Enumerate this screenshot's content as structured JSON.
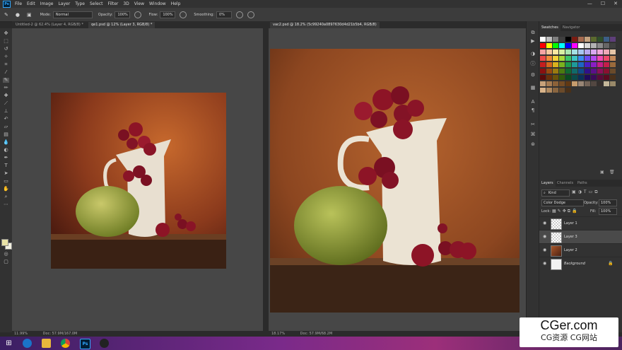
{
  "app": {
    "logo": "Ps"
  },
  "menu": [
    "File",
    "Edit",
    "Image",
    "Layer",
    "Type",
    "Select",
    "Filter",
    "3D",
    "View",
    "Window",
    "Help"
  ],
  "window_controls": [
    "—",
    "☐",
    "✕"
  ],
  "options": {
    "mode_label": "Mode:",
    "mode_value": "Normal",
    "opacity_label": "Opacity:",
    "opacity_value": "100%",
    "flow_label": "Flow:",
    "flow_value": "100%",
    "smoothing_label": "Smoothing:",
    "smoothing_value": "0%"
  },
  "tabs": {
    "left_1": "Untitled-2 @ 62.4% (Layer 4, RGB/8) *",
    "left_2": "qe1.psd @ 12% (Layer 3, RGB/8) *",
    "right_1": "vac2.psd @ 18.2% (5c99240a0897630d4d21b5b4, RGB/8)"
  },
  "status": {
    "left_zoom": "11.99%",
    "left_doc": "Doc: 57.9M/167.0M",
    "right_zoom": "18.17%",
    "right_doc": "Doc: 57.9M/68.2M"
  },
  "panels": {
    "swatches_tab": "Swatches",
    "navigator_tab": "Navigator",
    "layers_tab": "Layers",
    "channels_tab": "Channels",
    "paths_tab": "Paths",
    "kind_label": "Kind",
    "blend_mode": "Color Dodge",
    "opacity_label": "Opacity:",
    "opacity_value": "100%",
    "lock_label": "Lock:",
    "fill_label": "Fill:",
    "fill_value": "100%"
  },
  "layers": [
    {
      "name": "Layer 1",
      "selected": false
    },
    {
      "name": "Layer 3",
      "selected": true
    },
    {
      "name": "Layer 2",
      "selected": false
    },
    {
      "name": "Background",
      "selected": false
    }
  ],
  "watermark": {
    "line1": "CGer.com",
    "line2": "CG资源 CG网站"
  },
  "colors": {
    "accent": "#31a8ff",
    "foreground_swatch": "#e9e2a6",
    "background_swatch": "#f2f0e0"
  }
}
